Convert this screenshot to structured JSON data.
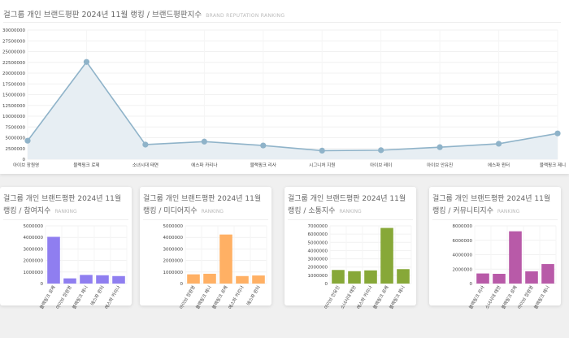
{
  "main": {
    "title": "걸그룹 개인 브랜드평판 2024년 11월 랭킹 / 브랜드평판지수",
    "subtitle": "BRAND REPUTATION RANKING"
  },
  "small_cards": [
    {
      "title": "걸그룹 개인 브랜드평판 2024년 11월 랭킹 / 참여지수",
      "subtitle": "RANKING"
    },
    {
      "title": "걸그룹 개인 브랜드평판 2024년 11월 랭킹 / 미디어지수",
      "subtitle": "RANKING"
    },
    {
      "title": "걸그룹 개인 브랜드평판 2024년 11월 랭킹 / 소통지수",
      "subtitle": "RANKING"
    },
    {
      "title": "걸그룹 개인 브랜드평판 2024년 11월 랭킹 / 커뮤니티지수",
      "subtitle": "RANKING"
    }
  ],
  "chart_data": [
    {
      "type": "area",
      "title": "걸그룹 개인 브랜드평판 2024년 11월 랭킹 / 브랜드평판지수",
      "categories": [
        "아이브 장원영",
        "블랙핑크 로제",
        "소녀시대 태연",
        "에스파 카리나",
        "블랙핑크 리사",
        "시그니처 지원",
        "아이브 레이",
        "아이브 안유진",
        "에스파 윈터",
        "블랙핑크 제니"
      ],
      "values": [
        4300000,
        22600000,
        3400000,
        4100000,
        3200000,
        2000000,
        2100000,
        2800000,
        3600000,
        6000000
      ],
      "ylim": [
        0,
        30000000
      ],
      "yticks": [
        0,
        2500000,
        5000000,
        7500000,
        10000000,
        12500000,
        15000000,
        17500000,
        20000000,
        22500000,
        25000000,
        27500000,
        30000000
      ],
      "color": "#8fb3c9",
      "fill": "#e7eef3"
    },
    {
      "type": "bar",
      "categories": [
        "블랙핑크 로제",
        "아이브 장원영",
        "블랙핑크 제니",
        "에스파 윈터",
        "에스파 카리나"
      ],
      "values": [
        4050000,
        450000,
        750000,
        720000,
        650000
      ],
      "ylim": [
        0,
        5000000
      ],
      "yticks": [
        0,
        1000000,
        2000000,
        3000000,
        4000000,
        5000000
      ],
      "color": "#8f7ef0"
    },
    {
      "type": "bar",
      "categories": [
        "아이브 장원영",
        "블랙핑크 제니",
        "블랙핑크 로제",
        "에스파 카리나",
        "에스파 윈터"
      ],
      "values": [
        800000,
        850000,
        4250000,
        650000,
        700000
      ],
      "ylim": [
        0,
        5000000
      ],
      "yticks": [
        0,
        1000000,
        2000000,
        3000000,
        4000000,
        5000000
      ],
      "color": "#ffb064"
    },
    {
      "type": "bar",
      "categories": [
        "아이브 안유진",
        "소녀시대 태연",
        "에스파 카리나",
        "블랙핑크 로제",
        "블랙핑크 제니"
      ],
      "values": [
        1650000,
        1500000,
        1600000,
        6750000,
        1750000
      ],
      "ylim": [
        0,
        7000000
      ],
      "yticks": [
        0,
        1000000,
        2000000,
        3000000,
        4000000,
        5000000,
        6000000,
        7000000
      ],
      "color": "#87a838"
    },
    {
      "type": "bar",
      "categories": [
        "블랙핑크 리사",
        "소녀시대 태연",
        "블랙핑크 로제",
        "아이브 장원영",
        "블랙핑크 제니"
      ],
      "values": [
        1400000,
        1350000,
        7250000,
        1700000,
        2700000
      ],
      "ylim": [
        0,
        8000000
      ],
      "yticks": [
        0,
        2000000,
        4000000,
        6000000,
        8000000
      ],
      "color": "#b85aa8"
    }
  ]
}
